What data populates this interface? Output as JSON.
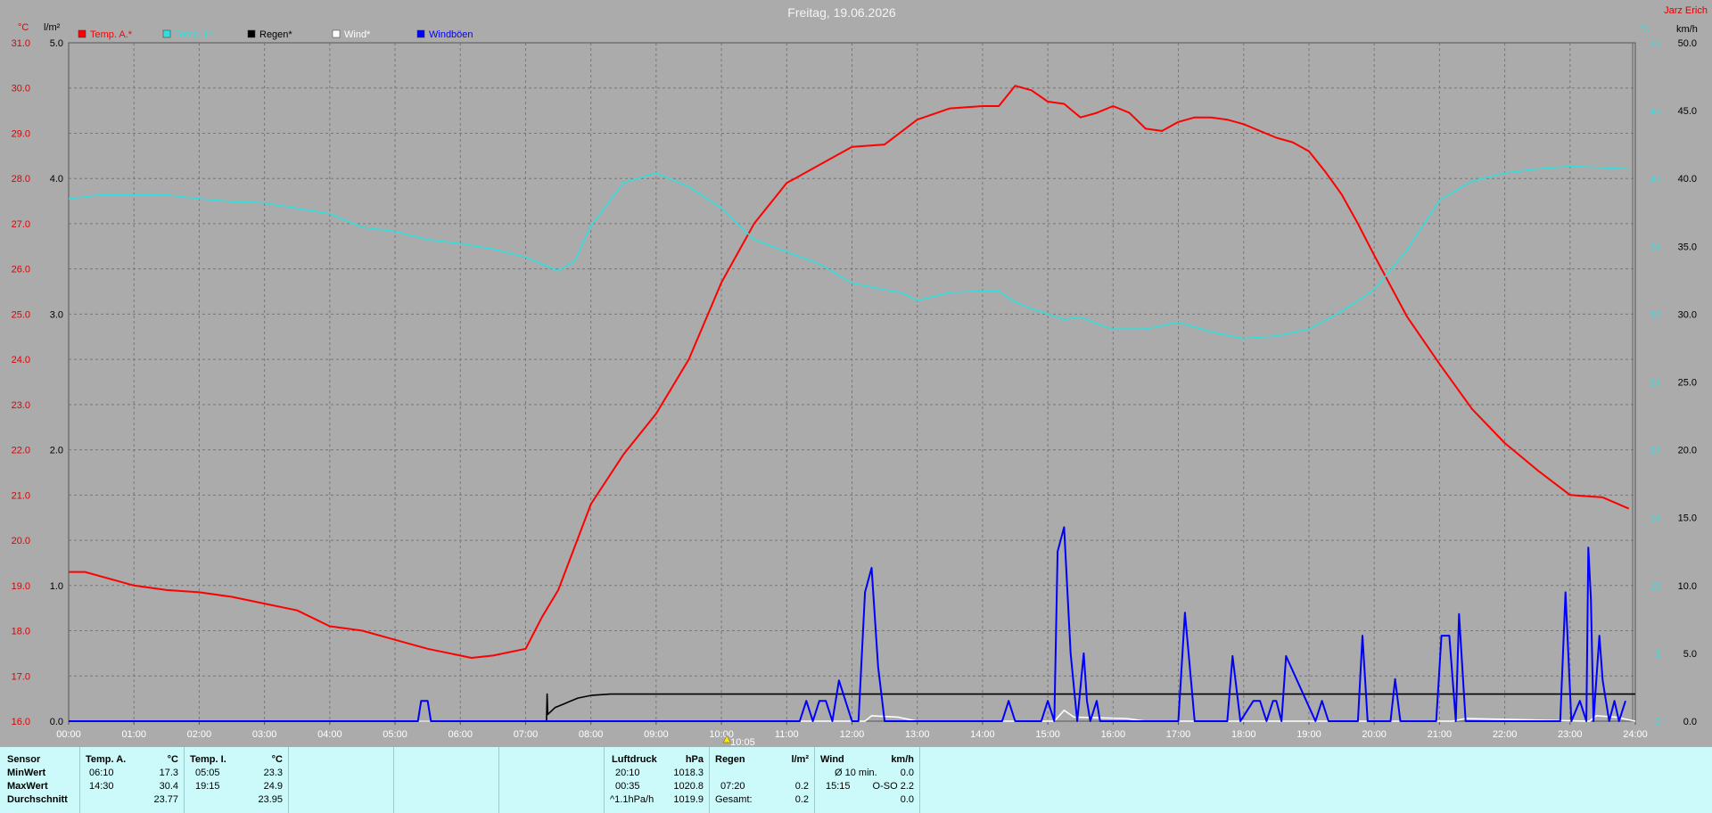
{
  "title": "Freitag, 19.06.2026",
  "station": "Jarz Erich",
  "units": {
    "temp": "°C",
    "rain": "l/m²",
    "wind": "km/h"
  },
  "legend": [
    {
      "label": "Temp. A.*",
      "color": "#ff0000"
    },
    {
      "label": "Temp. I.*",
      "color": "#33dddd"
    },
    {
      "label": "Regen*",
      "color": "#000000"
    },
    {
      "label": "Wind*",
      "color": "#ffffff"
    },
    {
      "label": "Windböen",
      "color": "#0000ff"
    }
  ],
  "marker": "10:05",
  "chart_data": {
    "type": "line",
    "title": "Freitag, 19.06.2026",
    "x_ticks": [
      "00:00",
      "01:00",
      "02:00",
      "03:00",
      "04:00",
      "05:00",
      "06:00",
      "07:00",
      "08:00",
      "09:00",
      "10:00",
      "11:00",
      "12:00",
      "13:00",
      "14:00",
      "15:00",
      "16:00",
      "17:00",
      "18:00",
      "19:00",
      "20:00",
      "21:00",
      "22:00",
      "23:00",
      "24:00"
    ],
    "y_left_temp_ticks": [
      "31.0",
      "30.0",
      "29.0",
      "28.0",
      "27.0",
      "26.0",
      "25.0",
      "24.0",
      "23.0",
      "22.0",
      "21.0",
      "20.0",
      "19.0",
      "18.0",
      "17.0",
      "16.0"
    ],
    "y_left_rain_ticks": [
      "5.0",
      "4.0",
      "3.0",
      "2.0",
      "1.0",
      "0.0"
    ],
    "y_right_wind_ticks": [
      "50.0",
      "45.0",
      "40.0",
      "35.0",
      "30.0",
      "25.0",
      "20.0",
      "15.0",
      "10.0",
      "5.0",
      "0.0"
    ],
    "y_right_inner_ticks": [
      "50",
      "45",
      "40",
      "35",
      "30",
      "25",
      "20",
      "15",
      "10",
      "5",
      "0"
    ],
    "ylim_temp": [
      16,
      31
    ],
    "ylim_rain": [
      0,
      5
    ],
    "ylim_wind": [
      0,
      50
    ],
    "xlim_hours": [
      0,
      24
    ],
    "grid": true,
    "legend_position": "top-left",
    "series": [
      {
        "name": "Temp. A.*",
        "color": "#ff0000",
        "axis": "temp",
        "x": [
          0,
          0.25,
          0.5,
          1,
          1.5,
          2,
          2.5,
          3,
          3.5,
          4,
          4.5,
          5,
          5.5,
          6,
          6.17,
          6.5,
          7,
          7.25,
          7.5,
          8,
          8.5,
          9,
          9.5,
          10,
          10.5,
          11,
          11.5,
          12,
          12.5,
          13,
          13.5,
          14,
          14.25,
          14.5,
          14.75,
          15,
          15.25,
          15.5,
          15.75,
          16,
          16.25,
          16.5,
          16.75,
          17,
          17.25,
          17.5,
          17.75,
          18,
          18.25,
          18.5,
          18.75,
          19,
          19.25,
          19.5,
          19.75,
          20,
          20.5,
          21,
          21.5,
          22,
          22.5,
          23,
          23.5,
          23.9
        ],
        "y": [
          19.3,
          19.3,
          19.2,
          19.0,
          18.9,
          18.85,
          18.75,
          18.6,
          18.45,
          18.1,
          18.0,
          17.8,
          17.6,
          17.45,
          17.4,
          17.45,
          17.6,
          18.3,
          18.9,
          20.8,
          21.9,
          22.8,
          24.0,
          25.7,
          27.0,
          27.9,
          28.3,
          28.7,
          28.75,
          29.3,
          29.55,
          29.6,
          29.6,
          30.05,
          29.95,
          29.7,
          29.65,
          29.35,
          29.45,
          29.6,
          29.45,
          29.1,
          29.05,
          29.25,
          29.35,
          29.35,
          29.3,
          29.2,
          29.05,
          28.9,
          28.8,
          28.6,
          28.15,
          27.65,
          27.0,
          26.3,
          24.95,
          23.9,
          22.9,
          22.15,
          21.55,
          21.0,
          20.95,
          20.7
        ]
      },
      {
        "name": "Temp. I.*",
        "color": "#33dddd",
        "axis": "wind",
        "x": [
          0,
          0.5,
          1,
          1.5,
          2,
          2.5,
          3,
          3.5,
          4,
          4.5,
          5,
          5.5,
          6,
          6.5,
          7,
          7.5,
          7.75,
          8,
          8.5,
          9,
          9.5,
          10,
          10.5,
          11,
          11.5,
          12,
          12.5,
          12.75,
          13,
          13.5,
          14,
          14.25,
          14.5,
          14.75,
          15,
          15.25,
          15.5,
          15.75,
          16,
          16.5,
          17,
          17.5,
          18,
          18.5,
          19,
          19.5,
          20,
          20.5,
          21,
          21.5,
          22,
          22.5,
          23,
          23.5,
          23.9
        ],
        "y": [
          38.5,
          38.8,
          38.8,
          38.8,
          38.5,
          38.3,
          38.2,
          37.8,
          37.4,
          36.4,
          36.1,
          35.5,
          35.2,
          34.8,
          34.2,
          33.2,
          33.9,
          36.5,
          39.7,
          40.4,
          39.4,
          37.8,
          35.5,
          34.6,
          33.7,
          32.3,
          31.8,
          31.6,
          31.0,
          31.6,
          31.7,
          31.7,
          30.9,
          30.4,
          30.0,
          29.6,
          29.8,
          29.3,
          28.9,
          28.9,
          29.4,
          28.7,
          28.2,
          28.4,
          28.9,
          30.2,
          31.8,
          34.7,
          38.4,
          39.8,
          40.4,
          40.7,
          40.9,
          40.8,
          40.7
        ]
      },
      {
        "name": "Regen*",
        "color": "#000000",
        "axis": "rain",
        "x": [
          0,
          7.32,
          7.33,
          7.34,
          7.45,
          7.6,
          7.8,
          8.0,
          8.3,
          8.6,
          9.0,
          24
        ],
        "y": [
          0.0,
          0.0,
          0.2,
          0.05,
          0.1,
          0.13,
          0.17,
          0.19,
          0.2,
          0.2,
          0.2,
          0.2
        ]
      },
      {
        "name": "Wind*",
        "color": "#ffffff",
        "axis": "wind",
        "x": [
          0,
          12.2,
          12.3,
          12.7,
          13,
          15.1,
          15.25,
          15.4,
          16.2,
          16.5,
          20,
          21.2,
          21.4,
          23.3,
          23.4,
          23.7,
          24
        ],
        "y": [
          0,
          0,
          0.4,
          0.3,
          0,
          0,
          0.8,
          0.3,
          0.2,
          0,
          0,
          0,
          0.2,
          0,
          0.4,
          0.3,
          0
        ]
      },
      {
        "name": "Windböen",
        "color": "#0000ff",
        "axis": "wind",
        "x": [
          0,
          5.35,
          5.4,
          5.5,
          5.55,
          11.2,
          11.3,
          11.4,
          11.5,
          11.6,
          11.7,
          11.8,
          11.9,
          12.0,
          12.1,
          12.2,
          12.3,
          12.4,
          12.5,
          14.3,
          14.4,
          14.5,
          14.9,
          15.0,
          15.1,
          15.15,
          15.25,
          15.35,
          15.45,
          15.55,
          15.6,
          15.65,
          15.75,
          15.8,
          15.9,
          17.0,
          17.1,
          17.25,
          17.75,
          17.83,
          17.95,
          18.15,
          18.25,
          18.35,
          18.45,
          18.5,
          18.58,
          18.65,
          19.1,
          19.2,
          19.3,
          19.75,
          19.82,
          19.9,
          20.25,
          20.32,
          20.4,
          20.95,
          21.03,
          21.15,
          21.25,
          21.3,
          21.4,
          22.85,
          22.93,
          23.02,
          23.15,
          23.25,
          23.28,
          23.32,
          23.36,
          23.45,
          23.5,
          23.6,
          23.68,
          23.75,
          23.85
        ],
        "y": [
          0,
          0,
          1.5,
          1.5,
          0,
          0,
          1.5,
          0,
          1.5,
          1.5,
          0,
          3.0,
          1.5,
          0,
          0,
          9.5,
          11.3,
          4.0,
          0,
          0,
          1.5,
          0,
          0,
          1.5,
          0,
          12.5,
          14.3,
          5.0,
          0,
          5.0,
          1.5,
          0,
          1.5,
          0,
          0,
          0,
          8.0,
          0,
          0,
          4.8,
          0,
          1.5,
          1.5,
          0,
          1.5,
          1.5,
          0,
          4.8,
          0,
          1.5,
          0,
          0,
          6.3,
          0,
          0,
          3.1,
          0,
          0,
          6.3,
          6.3,
          0,
          7.9,
          0,
          0,
          9.5,
          0,
          1.5,
          0,
          12.8,
          9.0,
          0,
          6.3,
          3.0,
          0,
          1.5,
          0,
          1.5
        ]
      }
    ]
  },
  "stats": {
    "labels": [
      "Sensor",
      "MinWert",
      "MaxWert",
      "Durchschnitt"
    ],
    "temp_a": {
      "header": "Temp. A.",
      "unit": "°C",
      "rows": [
        [
          "06:10",
          "17.3"
        ],
        [
          "14:30",
          "30.4"
        ],
        [
          "",
          "23.77"
        ]
      ]
    },
    "temp_i": {
      "header": "Temp. I.",
      "unit": "°C",
      "rows": [
        [
          "05:05",
          "23.3"
        ],
        [
          "19:15",
          "24.9"
        ],
        [
          "",
          "23.95"
        ]
      ]
    },
    "pressure": {
      "header": "Luftdruck",
      "unit": "hPa",
      "rows": [
        [
          "20:10",
          "1018.3"
        ],
        [
          "00:35",
          "1020.8"
        ],
        [
          "^1.1hPa/h",
          "1019.9"
        ]
      ]
    },
    "rain": {
      "header": "Regen",
      "unit": "l/m²",
      "rows": [
        [
          "",
          ""
        ],
        [
          "07:20",
          "0.2"
        ],
        [
          "Gesamt:",
          "0.2"
        ]
      ]
    },
    "wind": {
      "header": "Wind",
      "unit": "km/h",
      "rows": [
        [
          "Ø 10 min.",
          "0.0"
        ],
        [
          "15:15",
          "O-SO 2.2"
        ],
        [
          "",
          "0.0"
        ]
      ]
    }
  }
}
